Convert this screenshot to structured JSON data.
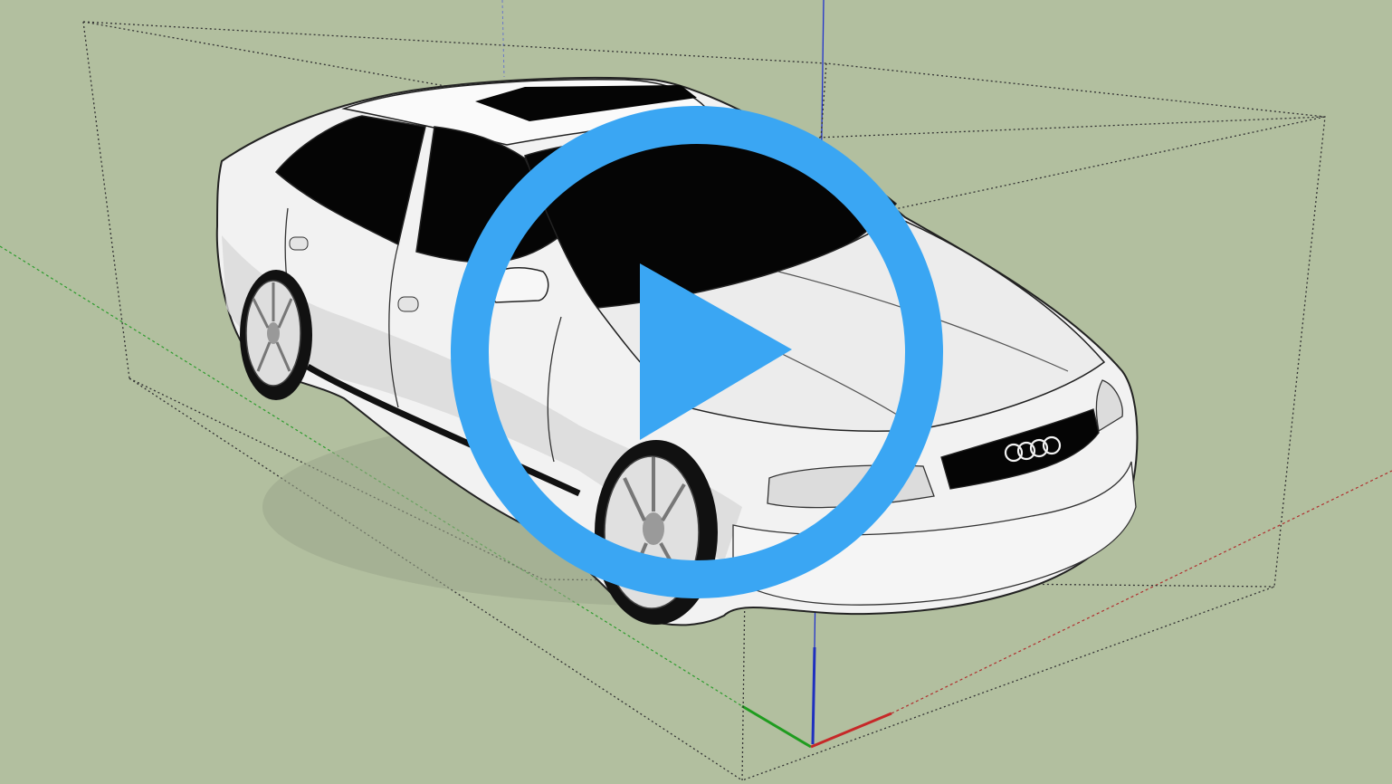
{
  "video": {
    "play_label": "",
    "play_icon": "play-icon"
  },
  "scene": {
    "background_color": "#b2bf9f",
    "axis_colors": {
      "red": "#c62828",
      "green": "#1f9c1f",
      "blue": "#1f2fbf"
    },
    "model": "car-model",
    "grille_badge": "four-rings-logo",
    "bounding_box": "dashed-bounding-box"
  },
  "colors": {
    "play_accent": "#3aa6f3",
    "car_body": "#f2f2f2",
    "glass": "#050505"
  }
}
